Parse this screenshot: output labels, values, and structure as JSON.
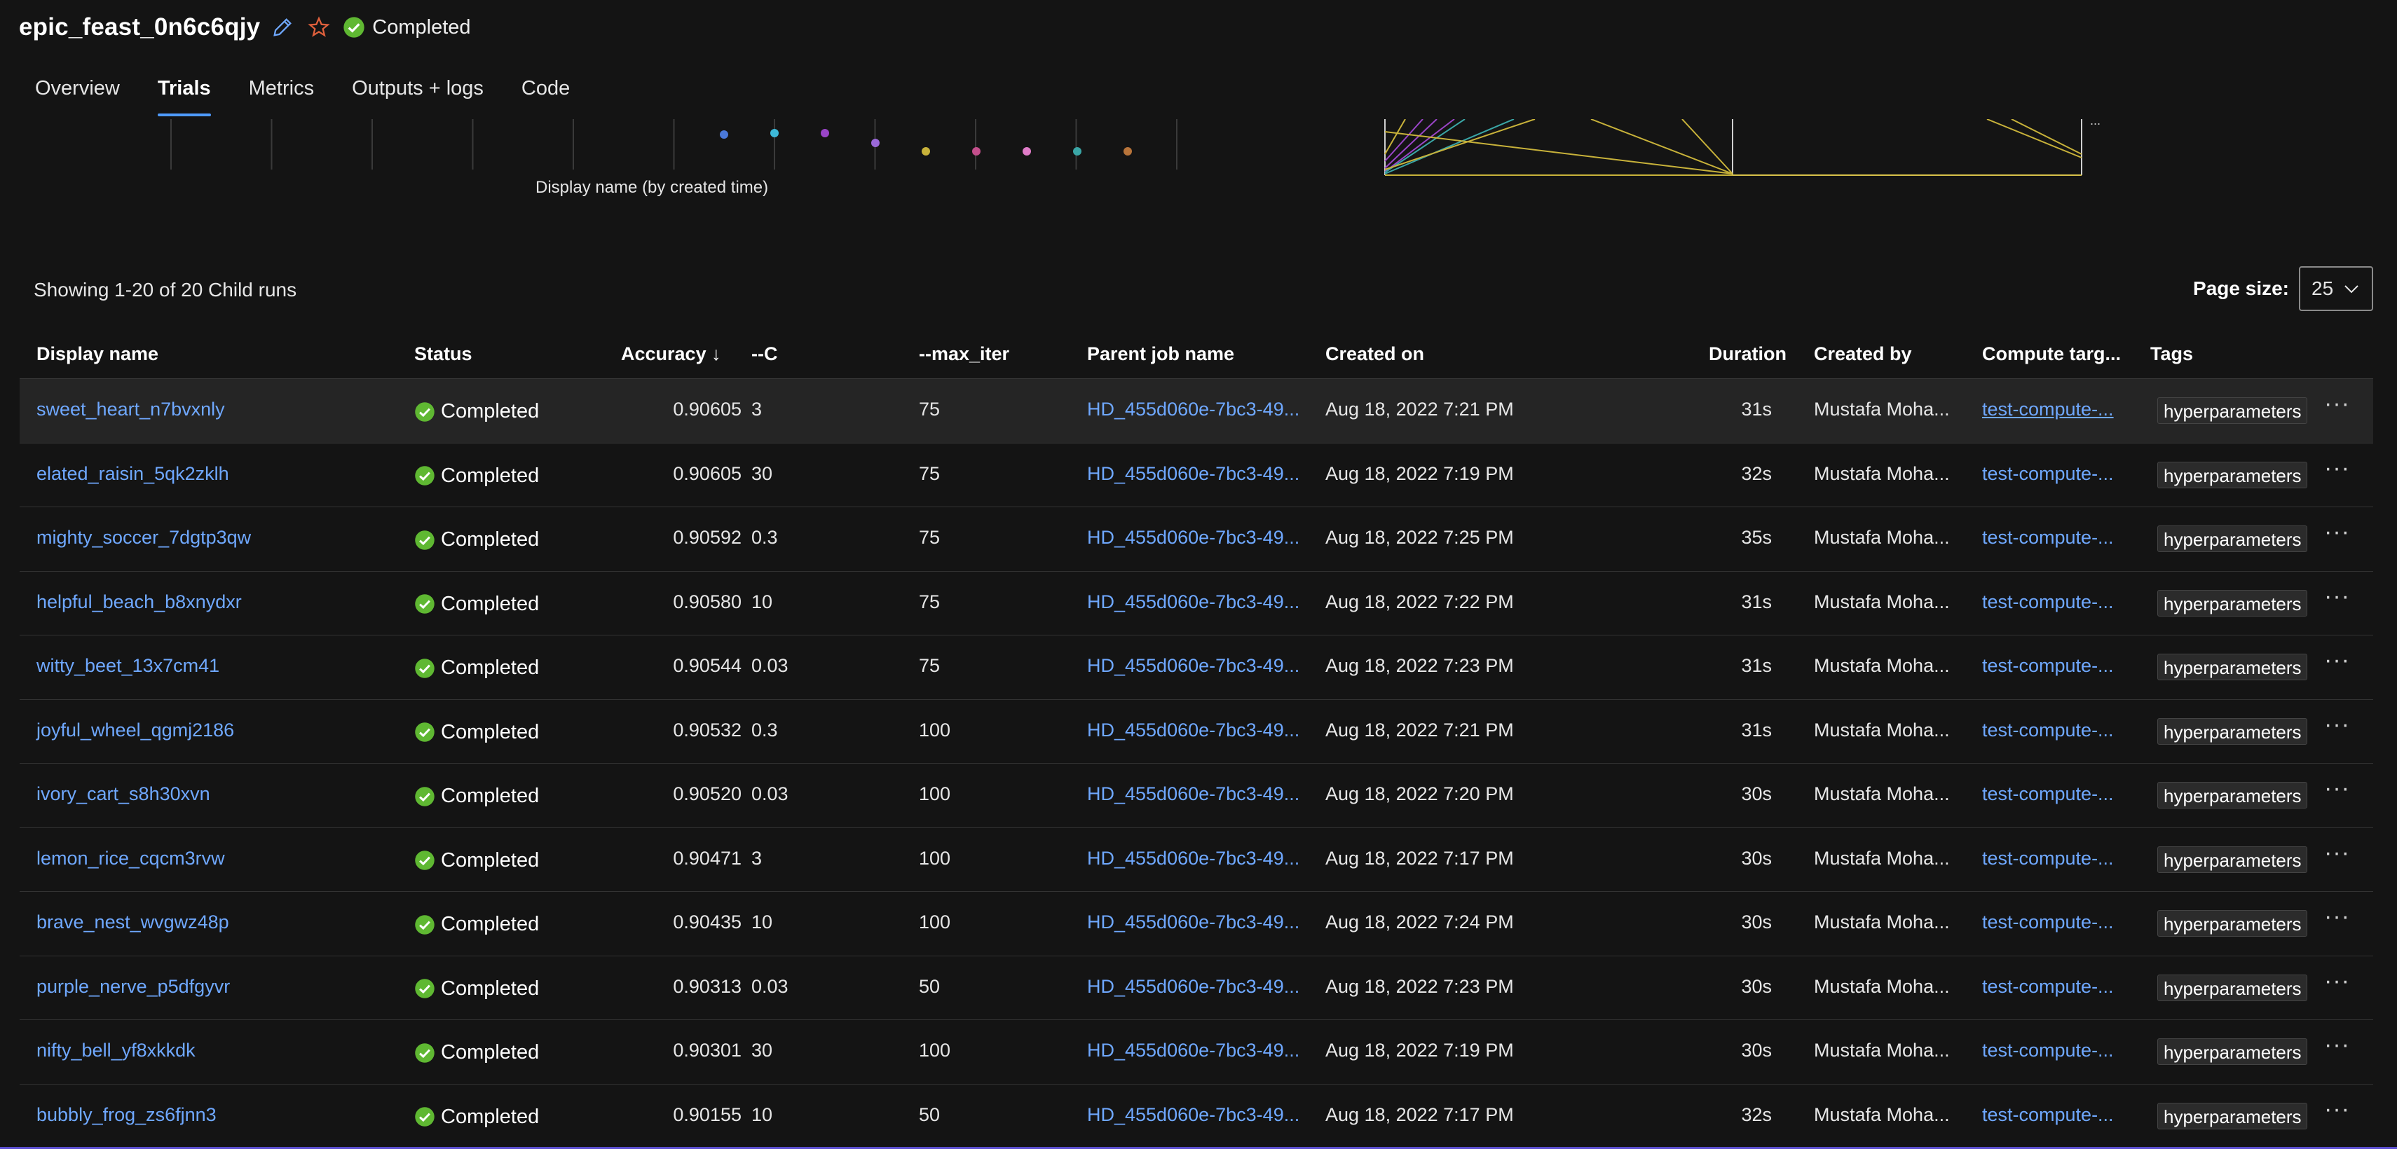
{
  "job": {
    "title": "epic_feast_0n6c6qjy",
    "status": "Completed",
    "icons": [
      "pencil-icon",
      "star-icon",
      "check-circle-icon"
    ]
  },
  "tabs": [
    {
      "label": "Overview"
    },
    {
      "label": "Trials",
      "active": true
    },
    {
      "label": "Metrics"
    },
    {
      "label": "Outputs + logs"
    },
    {
      "label": "Code"
    }
  ],
  "chart": {
    "xlabel": "Display name (by created time)",
    "dot_colors": [
      "#4a78d8",
      "#3db8d8",
      "#9a45c8",
      "#9a68d8",
      "#c8b23a",
      "#c44f8c",
      "#e07cc8",
      "#3aa6a6",
      "#b8743a"
    ]
  },
  "table_info": {
    "showing": "Showing 1-20 of 20 Child runs",
    "page_size_label": "Page size:",
    "page_size_value": "25"
  },
  "columns": [
    "Display name",
    "Status",
    "Accuracy ↓",
    "--C",
    "--max_iter",
    "Parent job name",
    "Created on",
    "Duration",
    "Created by",
    "Compute targ...",
    "Tags"
  ],
  "rows": [
    {
      "name": "sweet_heart_n7bvxnly",
      "status": "Completed",
      "accuracy": "0.90605",
      "c": "3",
      "max_iter": "75",
      "parent": "HD_455d060e-7bc3-49...",
      "created": "Aug 18, 2022 7:21 PM",
      "duration": "31s",
      "by": "Mustafa Moha...",
      "compute": "test-compute-...",
      "tag": "hyperparameters"
    },
    {
      "name": "elated_raisin_5qk2zklh",
      "status": "Completed",
      "accuracy": "0.90605",
      "c": "30",
      "max_iter": "75",
      "parent": "HD_455d060e-7bc3-49...",
      "created": "Aug 18, 2022 7:19 PM",
      "duration": "32s",
      "by": "Mustafa Moha...",
      "compute": "test-compute-...",
      "tag": "hyperparameters"
    },
    {
      "name": "mighty_soccer_7dgtp3qw",
      "status": "Completed",
      "accuracy": "0.90592",
      "c": "0.3",
      "max_iter": "75",
      "parent": "HD_455d060e-7bc3-49...",
      "created": "Aug 18, 2022 7:25 PM",
      "duration": "35s",
      "by": "Mustafa Moha...",
      "compute": "test-compute-...",
      "tag": "hyperparameters"
    },
    {
      "name": "helpful_beach_b8xnydxr",
      "status": "Completed",
      "accuracy": "0.90580",
      "c": "10",
      "max_iter": "75",
      "parent": "HD_455d060e-7bc3-49...",
      "created": "Aug 18, 2022 7:22 PM",
      "duration": "31s",
      "by": "Mustafa Moha...",
      "compute": "test-compute-...",
      "tag": "hyperparameters"
    },
    {
      "name": "witty_beet_13x7cm41",
      "status": "Completed",
      "accuracy": "0.90544",
      "c": "0.03",
      "max_iter": "75",
      "parent": "HD_455d060e-7bc3-49...",
      "created": "Aug 18, 2022 7:23 PM",
      "duration": "31s",
      "by": "Mustafa Moha...",
      "compute": "test-compute-...",
      "tag": "hyperparameters"
    },
    {
      "name": "joyful_wheel_qgmj2186",
      "status": "Completed",
      "accuracy": "0.90532",
      "c": "0.3",
      "max_iter": "100",
      "parent": "HD_455d060e-7bc3-49...",
      "created": "Aug 18, 2022 7:21 PM",
      "duration": "31s",
      "by": "Mustafa Moha...",
      "compute": "test-compute-...",
      "tag": "hyperparameters"
    },
    {
      "name": "ivory_cart_s8h30xvn",
      "status": "Completed",
      "accuracy": "0.90520",
      "c": "0.03",
      "max_iter": "100",
      "parent": "HD_455d060e-7bc3-49...",
      "created": "Aug 18, 2022 7:20 PM",
      "duration": "30s",
      "by": "Mustafa Moha...",
      "compute": "test-compute-...",
      "tag": "hyperparameters"
    },
    {
      "name": "lemon_rice_cqcm3rvw",
      "status": "Completed",
      "accuracy": "0.90471",
      "c": "3",
      "max_iter": "100",
      "parent": "HD_455d060e-7bc3-49...",
      "created": "Aug 18, 2022 7:17 PM",
      "duration": "30s",
      "by": "Mustafa Moha...",
      "compute": "test-compute-...",
      "tag": "hyperparameters"
    },
    {
      "name": "brave_nest_wvgwz48p",
      "status": "Completed",
      "accuracy": "0.90435",
      "c": "10",
      "max_iter": "100",
      "parent": "HD_455d060e-7bc3-49...",
      "created": "Aug 18, 2022 7:24 PM",
      "duration": "30s",
      "by": "Mustafa Moha...",
      "compute": "test-compute-...",
      "tag": "hyperparameters"
    },
    {
      "name": "purple_nerve_p5dfgyvr",
      "status": "Completed",
      "accuracy": "0.90313",
      "c": "0.03",
      "max_iter": "50",
      "parent": "HD_455d060e-7bc3-49...",
      "created": "Aug 18, 2022 7:23 PM",
      "duration": "30s",
      "by": "Mustafa Moha...",
      "compute": "test-compute-...",
      "tag": "hyperparameters"
    },
    {
      "name": "nifty_bell_yf8xkkdk",
      "status": "Completed",
      "accuracy": "0.90301",
      "c": "30",
      "max_iter": "100",
      "parent": "HD_455d060e-7bc3-49...",
      "created": "Aug 18, 2022 7:19 PM",
      "duration": "30s",
      "by": "Mustafa Moha...",
      "compute": "test-compute-...",
      "tag": "hyperparameters"
    },
    {
      "name": "bubbly_frog_zs6fjnn3",
      "status": "Completed",
      "accuracy": "0.90155",
      "c": "10",
      "max_iter": "50",
      "parent": "HD_455d060e-7bc3-49...",
      "created": "Aug 18, 2022 7:17 PM",
      "duration": "32s",
      "by": "Mustafa Moha...",
      "compute": "test-compute-...",
      "tag": "hyperparameters"
    }
  ],
  "row_more_label": "···"
}
